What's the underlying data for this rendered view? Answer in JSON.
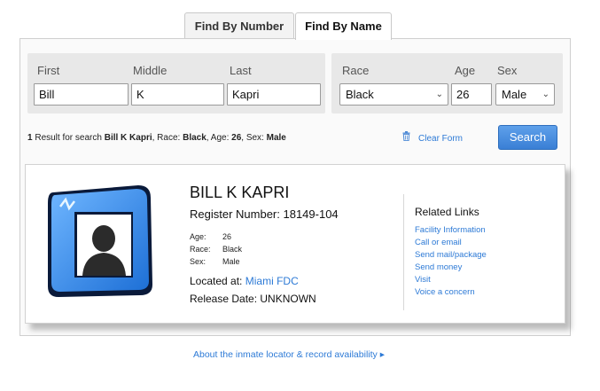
{
  "tabs": [
    {
      "label": "Find By Number",
      "active": false
    },
    {
      "label": "Find By Name",
      "active": true
    }
  ],
  "form": {
    "first_label": "First",
    "first_value": "Bill",
    "middle_label": "Middle",
    "middle_value": "K",
    "last_label": "Last",
    "last_value": "Kapri",
    "race_label": "Race",
    "race_value": "Black",
    "age_label": "Age",
    "age_value": "26",
    "sex_label": "Sex",
    "sex_value": "Male"
  },
  "summary": {
    "count": "1",
    "prefix": " Result for search ",
    "name": "Bill K Kapri",
    "race_label": ", Race: ",
    "race": "Black",
    "age_label": ", Age: ",
    "age": "26",
    "sex_label": ", Sex: ",
    "sex": "Male"
  },
  "actions": {
    "clear_label": "Clear Form",
    "search_label": "Search"
  },
  "result": {
    "name": "BILL K KAPRI",
    "register_number": "Register Number: 18149-104",
    "age_label": "Age:",
    "age_value": "26",
    "race_label": "Race:",
    "race_value": "Black",
    "sex_label": "Sex:",
    "sex_value": "Male",
    "located_label": "Located at:",
    "located_value": "Miami FDC",
    "release": "Release Date: UNKNOWN"
  },
  "related": {
    "title": "Related Links",
    "links": [
      "Facility Information",
      "Call or email",
      "Send mail/package",
      "Send money",
      "Visit",
      "Voice a concern"
    ]
  },
  "footer": {
    "about_link": "About the inmate locator & record availability ▸"
  },
  "colors": {
    "accent": "#2d7ad6",
    "button": "#3a7fd5",
    "avatar_frame": "#2f86e0"
  }
}
